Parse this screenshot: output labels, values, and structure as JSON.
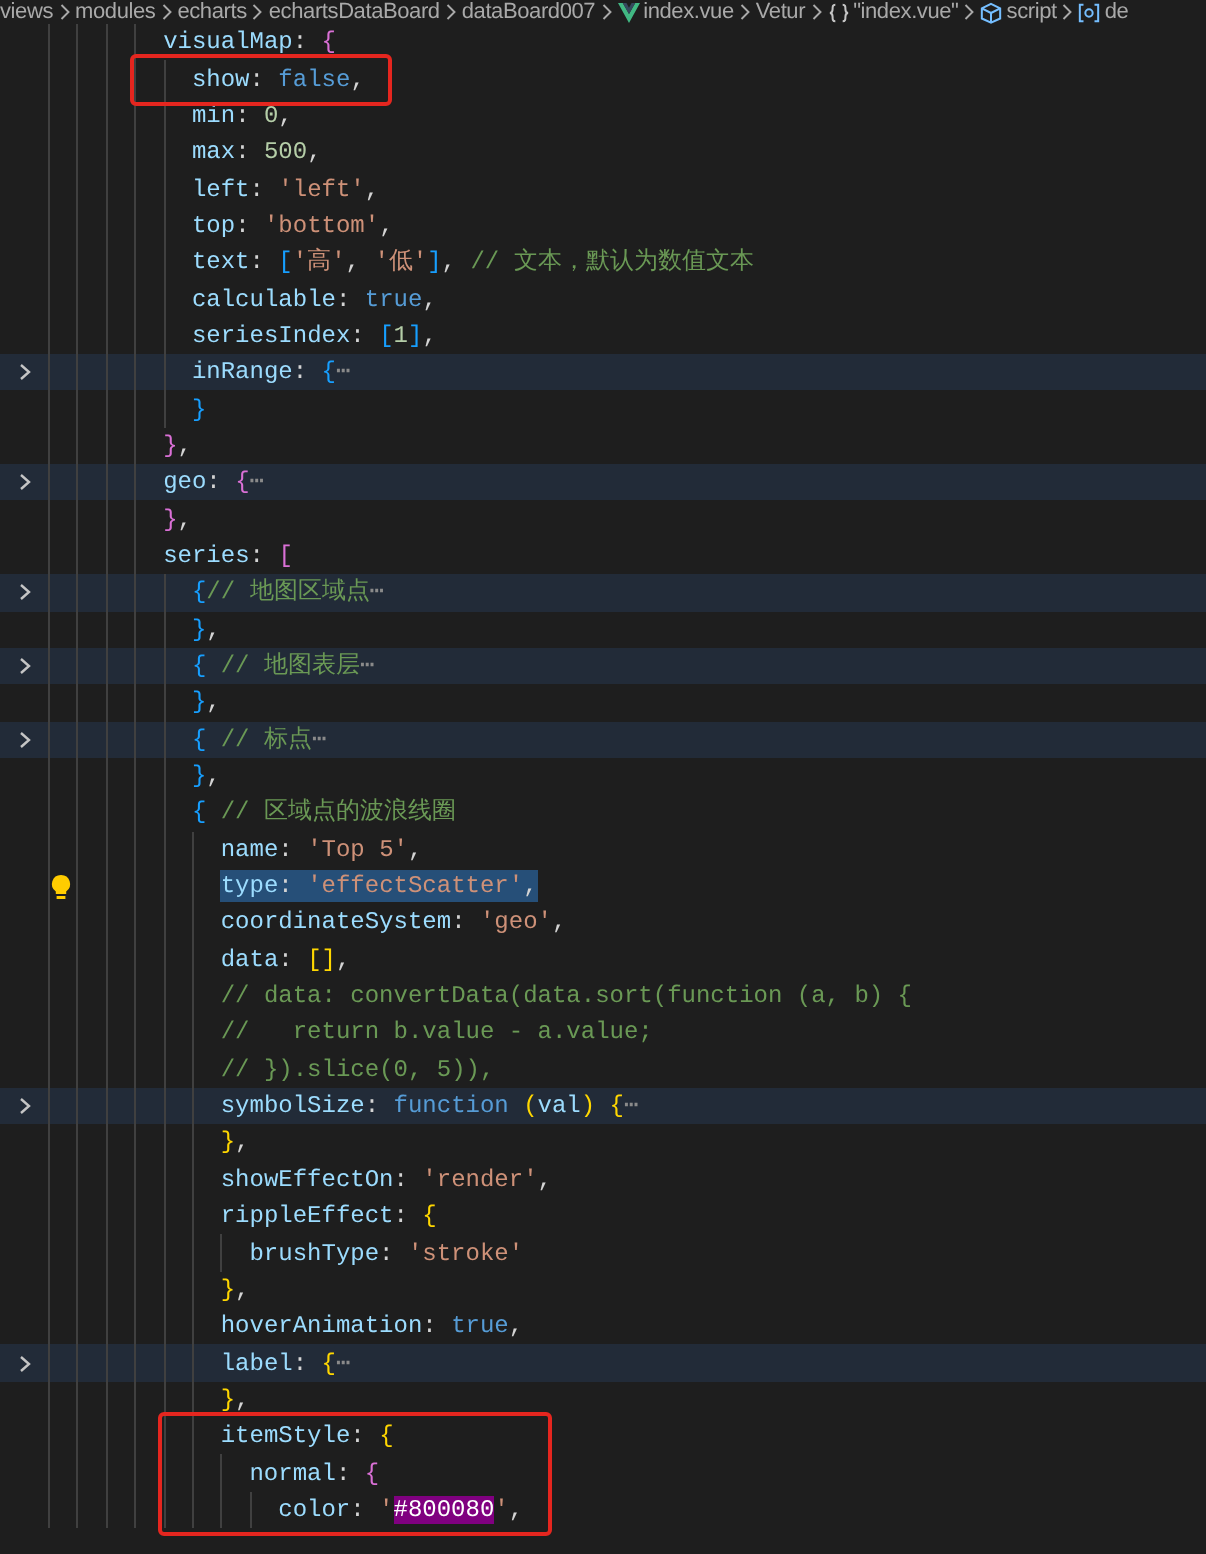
{
  "breadcrumb": [
    {
      "label": "views"
    },
    {
      "label": "modules"
    },
    {
      "label": "echarts"
    },
    {
      "label": "echartsDataBoard"
    },
    {
      "label": "dataBoard007"
    },
    {
      "label": "index.vue",
      "kind": "vue"
    },
    {
      "label": "Vetur"
    },
    {
      "label": "\"index.vue\"",
      "kind": "object"
    },
    {
      "label": "script",
      "kind": "module"
    },
    {
      "label": "de",
      "kind": "variable"
    }
  ],
  "lines": [
    {
      "tokens": [
        {
          "kind": "key",
          "text": "visualMap"
        },
        {
          "kind": "punct",
          "text": ": "
        },
        {
          "kind": "b2",
          "text": "{"
        }
      ],
      "children": [
        {
          "boxed": true,
          "tokens": [
            {
              "kind": "key",
              "text": "show"
            },
            {
              "kind": "punct",
              "text": ": "
            },
            {
              "kind": "keyword",
              "text": "false"
            },
            {
              "kind": "punct",
              "text": ","
            }
          ]
        },
        {
          "tokens": [
            {
              "kind": "key",
              "text": "min"
            },
            {
              "kind": "punct",
              "text": ": "
            },
            {
              "kind": "number",
              "text": "0"
            },
            {
              "kind": "punct",
              "text": ","
            }
          ]
        },
        {
          "tokens": [
            {
              "kind": "key",
              "text": "max"
            },
            {
              "kind": "punct",
              "text": ": "
            },
            {
              "kind": "number",
              "text": "500"
            },
            {
              "kind": "punct",
              "text": ","
            }
          ]
        },
        {
          "tokens": [
            {
              "kind": "key",
              "text": "left"
            },
            {
              "kind": "punct",
              "text": ": "
            },
            {
              "kind": "string",
              "text": "'left'"
            },
            {
              "kind": "punct",
              "text": ","
            }
          ]
        },
        {
          "tokens": [
            {
              "kind": "key",
              "text": "top"
            },
            {
              "kind": "punct",
              "text": ": "
            },
            {
              "kind": "string",
              "text": "'bottom'"
            },
            {
              "kind": "punct",
              "text": ","
            }
          ]
        },
        {
          "tokens": [
            {
              "kind": "key",
              "text": "text"
            },
            {
              "kind": "punct",
              "text": ": "
            },
            {
              "kind": "b3",
              "text": "["
            },
            {
              "kind": "string",
              "text": "'高'"
            },
            {
              "kind": "punct",
              "text": ", "
            },
            {
              "kind": "string",
              "text": "'低'"
            },
            {
              "kind": "b3",
              "text": "]"
            },
            {
              "kind": "punct",
              "text": ", "
            },
            {
              "kind": "comment",
              "text": "// 文本，默认为数值文本"
            }
          ]
        },
        {
          "tokens": [
            {
              "kind": "key",
              "text": "calculable"
            },
            {
              "kind": "punct",
              "text": ": "
            },
            {
              "kind": "keyword",
              "text": "true"
            },
            {
              "kind": "punct",
              "text": ","
            }
          ]
        },
        {
          "tokens": [
            {
              "kind": "key",
              "text": "seriesIndex"
            },
            {
              "kind": "punct",
              "text": ": "
            },
            {
              "kind": "b3",
              "text": "["
            },
            {
              "kind": "number",
              "text": "1"
            },
            {
              "kind": "b3",
              "text": "]"
            },
            {
              "kind": "punct",
              "text": ","
            }
          ]
        },
        {
          "folded": true,
          "tokens": [
            {
              "kind": "key",
              "text": "inRange"
            },
            {
              "kind": "punct",
              "text": ": "
            },
            {
              "kind": "b3",
              "text": "{"
            },
            {
              "kind": "ellipsis",
              "text": "⋯"
            }
          ]
        },
        {
          "tokens": [
            {
              "kind": "b3",
              "text": "}"
            }
          ]
        }
      ]
    },
    {
      "tokens": [
        {
          "kind": "b2",
          "text": "}"
        },
        {
          "kind": "punct",
          "text": ","
        }
      ]
    },
    {
      "folded": true,
      "tokens": [
        {
          "kind": "key",
          "text": "geo"
        },
        {
          "kind": "punct",
          "text": ": "
        },
        {
          "kind": "b2",
          "text": "{"
        },
        {
          "kind": "ellipsis",
          "text": "⋯"
        }
      ]
    },
    {
      "tokens": [
        {
          "kind": "b2",
          "text": "}"
        },
        {
          "kind": "punct",
          "text": ","
        }
      ]
    },
    {
      "tokens": [
        {
          "kind": "key",
          "text": "series"
        },
        {
          "kind": "punct",
          "text": ": "
        },
        {
          "kind": "b2",
          "text": "["
        }
      ],
      "children": [
        {
          "folded": true,
          "tokens": [
            {
              "kind": "b3",
              "text": "{"
            },
            {
              "kind": "comment",
              "text": "// 地图区域点"
            },
            {
              "kind": "ellipsis",
              "text": "⋯"
            }
          ]
        },
        {
          "tokens": [
            {
              "kind": "b3",
              "text": "}"
            },
            {
              "kind": "punct",
              "text": ","
            }
          ]
        },
        {
          "folded": true,
          "tokens": [
            {
              "kind": "b3",
              "text": "{"
            },
            {
              "kind": "comment",
              "text": " // 地图表层"
            },
            {
              "kind": "ellipsis",
              "text": "⋯"
            }
          ]
        },
        {
          "tokens": [
            {
              "kind": "b3",
              "text": "}"
            },
            {
              "kind": "punct",
              "text": ","
            }
          ]
        },
        {
          "folded": true,
          "tokens": [
            {
              "kind": "b3",
              "text": "{"
            },
            {
              "kind": "comment",
              "text": " // 标点"
            },
            {
              "kind": "ellipsis",
              "text": "⋯"
            }
          ]
        },
        {
          "tokens": [
            {
              "kind": "b3",
              "text": "}"
            },
            {
              "kind": "punct",
              "text": ","
            }
          ]
        },
        {
          "tokens": [
            {
              "kind": "b3",
              "text": "{"
            },
            {
              "kind": "comment",
              "text": " // 区域点的波浪线圈"
            }
          ],
          "children": [
            {
              "tokens": [
                {
                  "kind": "key",
                  "text": "name"
                },
                {
                  "kind": "punct",
                  "text": ": "
                },
                {
                  "kind": "string",
                  "text": "'Top 5'"
                },
                {
                  "kind": "punct",
                  "text": ","
                }
              ]
            },
            {
              "selected": true,
              "lightbulb": true,
              "tokens": [
                {
                  "kind": "key",
                  "text": "type"
                },
                {
                  "kind": "punct",
                  "text": ": "
                },
                {
                  "kind": "string",
                  "text": "'effectScatter'"
                },
                {
                  "kind": "punct",
                  "text": ","
                }
              ]
            },
            {
              "tokens": [
                {
                  "kind": "key",
                  "text": "coordinateSystem"
                },
                {
                  "kind": "punct",
                  "text": ": "
                },
                {
                  "kind": "string",
                  "text": "'geo'"
                },
                {
                  "kind": "punct",
                  "text": ","
                }
              ]
            },
            {
              "tokens": [
                {
                  "kind": "key",
                  "text": "data"
                },
                {
                  "kind": "punct",
                  "text": ": "
                },
                {
                  "kind": "b1",
                  "text": "[]"
                },
                {
                  "kind": "punct",
                  "text": ","
                }
              ]
            },
            {
              "tokens": [
                {
                  "kind": "comment",
                  "text": "// data: convertData(data.sort(function (a, b) {"
                }
              ]
            },
            {
              "tokens": [
                {
                  "kind": "comment",
                  "text": "//   return b.value - a.value;"
                }
              ]
            },
            {
              "tokens": [
                {
                  "kind": "comment",
                  "text": "// }).slice(0, 5)),"
                }
              ]
            },
            {
              "folded": true,
              "tokens": [
                {
                  "kind": "key",
                  "text": "symbolSize"
                },
                {
                  "kind": "punct",
                  "text": ": "
                },
                {
                  "kind": "keyword",
                  "text": "function"
                },
                {
                  "kind": "b1",
                  "text": " ("
                },
                {
                  "kind": "key",
                  "text": "val"
                },
                {
                  "kind": "b1",
                  "text": ")"
                },
                {
                  "kind": "b1",
                  "text": " {"
                },
                {
                  "kind": "ellipsis",
                  "text": "⋯"
                }
              ]
            },
            {
              "tokens": [
                {
                  "kind": "b1",
                  "text": "}"
                },
                {
                  "kind": "punct",
                  "text": ","
                }
              ]
            },
            {
              "tokens": [
                {
                  "kind": "key",
                  "text": "showEffectOn"
                },
                {
                  "kind": "punct",
                  "text": ": "
                },
                {
                  "kind": "string",
                  "text": "'render'"
                },
                {
                  "kind": "punct",
                  "text": ","
                }
              ]
            },
            {
              "tokens": [
                {
                  "kind": "key",
                  "text": "rippleEffect"
                },
                {
                  "kind": "punct",
                  "text": ": "
                },
                {
                  "kind": "b1",
                  "text": "{"
                }
              ],
              "children": [
                {
                  "tokens": [
                    {
                      "kind": "key",
                      "text": "brushType"
                    },
                    {
                      "kind": "punct",
                      "text": ": "
                    },
                    {
                      "kind": "string",
                      "text": "'stroke'"
                    }
                  ]
                }
              ]
            },
            {
              "tokens": [
                {
                  "kind": "b1",
                  "text": "}"
                },
                {
                  "kind": "punct",
                  "text": ","
                }
              ]
            },
            {
              "tokens": [
                {
                  "kind": "key",
                  "text": "hoverAnimation"
                },
                {
                  "kind": "punct",
                  "text": ": "
                },
                {
                  "kind": "keyword",
                  "text": "true"
                },
                {
                  "kind": "punct",
                  "text": ","
                }
              ]
            },
            {
              "folded": true,
              "tokens": [
                {
                  "kind": "key",
                  "text": "label"
                },
                {
                  "kind": "punct",
                  "text": ": "
                },
                {
                  "kind": "b1",
                  "text": "{"
                },
                {
                  "kind": "ellipsis",
                  "text": "⋯"
                }
              ]
            },
            {
              "tokens": [
                {
                  "kind": "b1",
                  "text": "}"
                },
                {
                  "kind": "punct",
                  "text": ","
                }
              ]
            },
            {
              "boxed": true,
              "tokens": [
                {
                  "kind": "key",
                  "text": "itemStyle"
                },
                {
                  "kind": "punct",
                  "text": ": "
                },
                {
                  "kind": "b1",
                  "text": "{"
                }
              ],
              "children": [
                {
                  "boxed": true,
                  "tokens": [
                    {
                      "kind": "key",
                      "text": "normal"
                    },
                    {
                      "kind": "punct",
                      "text": ": "
                    },
                    {
                      "kind": "b2",
                      "text": "{"
                    }
                  ],
                  "children": [
                    {
                      "boxed": true,
                      "tokens": [
                        {
                          "kind": "key",
                          "text": "color"
                        },
                        {
                          "kind": "punct",
                          "text": ": "
                        },
                        {
                          "kind": "string",
                          "text": "'"
                        },
                        {
                          "kind": "swatch",
                          "text": "#800080",
                          "color": "#800080"
                        },
                        {
                          "kind": "string",
                          "text": "'"
                        },
                        {
                          "kind": "punct",
                          "text": ","
                        }
                      ]
                    }
                  ]
                }
              ]
            }
          ]
        }
      ]
    }
  ]
}
